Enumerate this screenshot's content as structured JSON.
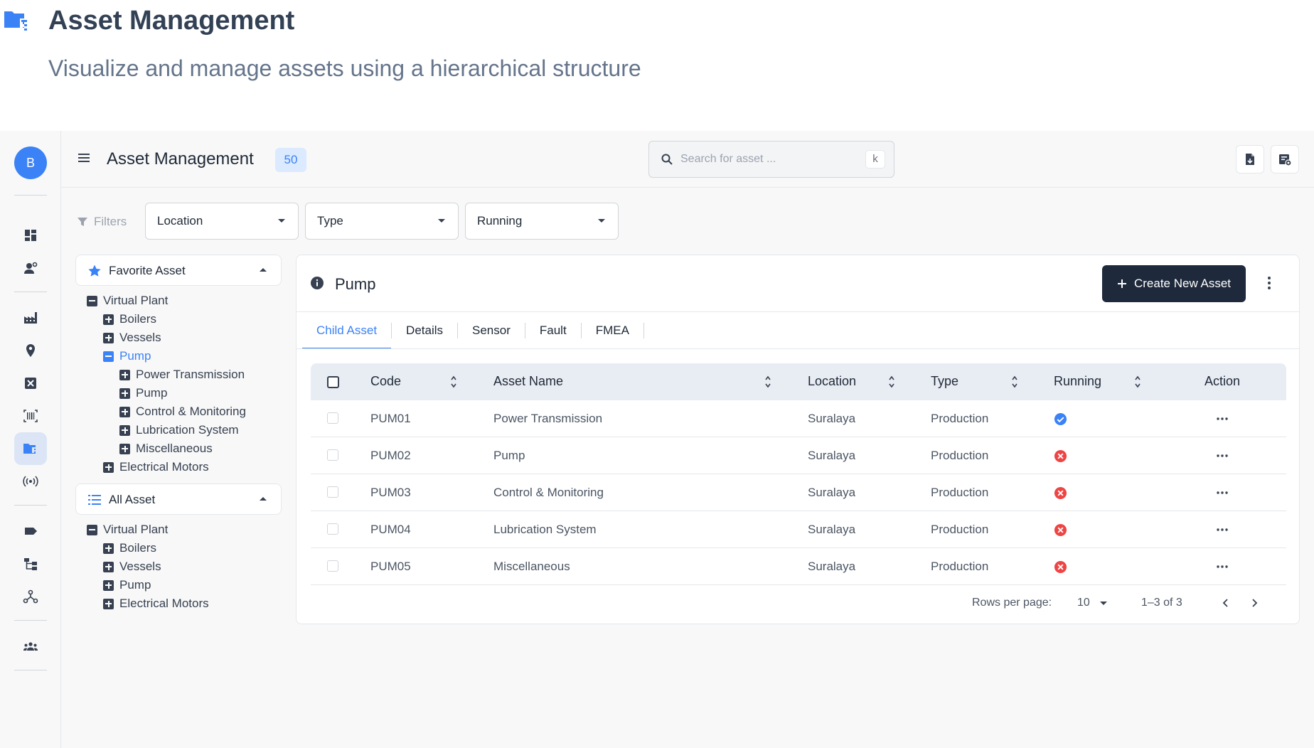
{
  "header": {
    "title": "Asset Management",
    "subtitle": "Visualize and manage assets using a hierarchical structure",
    "logo_icon": "folder-tree-icon"
  },
  "rail": {
    "avatar_letter": "B",
    "items": [
      "dashboard-icon",
      "user-settings-icon",
      "factory-icon",
      "location-pin-icon",
      "close-box-icon",
      "barcode-icon",
      "folder-tree-icon",
      "radio-signal-icon",
      "tag-icon",
      "hierarchy-icon",
      "network-icon",
      "team-icon"
    ],
    "active_item": "folder-tree-icon"
  },
  "topbar": {
    "title": "Asset Management",
    "count": "50",
    "search_placeholder": "Search for asset ...",
    "search_shortcut": "k",
    "tools": [
      "file-export-icon",
      "list-settings-icon"
    ]
  },
  "filters": {
    "label": "Filters",
    "selects": [
      {
        "label": "Location"
      },
      {
        "label": "Type"
      },
      {
        "label": "Running"
      }
    ]
  },
  "favorite_tree": {
    "heading": "Favorite Asset",
    "nodes": [
      {
        "label": "Virtual Plant",
        "level": 0,
        "state": "expanded"
      },
      {
        "label": "Boilers",
        "level": 1,
        "state": "collapsed"
      },
      {
        "label": "Vessels",
        "level": 1,
        "state": "collapsed"
      },
      {
        "label": "Pump",
        "level": 1,
        "state": "expanded",
        "selected": true
      },
      {
        "label": "Power Transmission",
        "level": 2,
        "state": "collapsed"
      },
      {
        "label": "Pump",
        "level": 2,
        "state": "collapsed"
      },
      {
        "label": "Control & Monitoring",
        "level": 2,
        "state": "collapsed"
      },
      {
        "label": "Lubrication System",
        "level": 2,
        "state": "collapsed"
      },
      {
        "label": "Miscellaneous",
        "level": 2,
        "state": "collapsed"
      },
      {
        "label": "Electrical Motors",
        "level": 1,
        "state": "collapsed"
      }
    ]
  },
  "all_tree": {
    "heading": "All Asset",
    "nodes": [
      {
        "label": "Virtual Plant",
        "level": 0,
        "state": "expanded"
      },
      {
        "label": "Boilers",
        "level": 1,
        "state": "collapsed"
      },
      {
        "label": "Vessels",
        "level": 1,
        "state": "collapsed"
      },
      {
        "label": "Pump",
        "level": 1,
        "state": "collapsed"
      },
      {
        "label": "Electrical Motors",
        "level": 1,
        "state": "collapsed"
      }
    ]
  },
  "detail": {
    "title": "Pump",
    "create_label": "Create New Asset",
    "tabs": [
      "Child Asset",
      "Details",
      "Sensor",
      "Fault",
      "FMEA"
    ],
    "active_tab": "Child Asset",
    "columns": [
      "Code",
      "Asset Name",
      "Location",
      "Type",
      "Running",
      "Action"
    ],
    "rows": [
      {
        "code": "PUM01",
        "name": "Power Transmission",
        "location": "Suralaya",
        "type": "Production",
        "running": true
      },
      {
        "code": "PUM02",
        "name": "Pump",
        "location": "Suralaya",
        "type": "Production",
        "running": false
      },
      {
        "code": "PUM03",
        "name": "Control & Monitoring",
        "location": "Suralaya",
        "type": "Production",
        "running": false
      },
      {
        "code": "PUM04",
        "name": "Lubrication System",
        "location": "Suralaya",
        "type": "Production",
        "running": false
      },
      {
        "code": "PUM05",
        "name": "Miscellaneous",
        "location": "Suralaya",
        "type": "Production",
        "running": false
      }
    ],
    "pagination": {
      "rows_per_page_label": "Rows per page:",
      "rows_per_page": "10",
      "range": "1–3  of  3"
    }
  },
  "colors": {
    "accent": "#3b82f6",
    "primary_button": "#1e293b",
    "running_ok": "#3b82f6",
    "running_stopped": "#ef4444"
  }
}
